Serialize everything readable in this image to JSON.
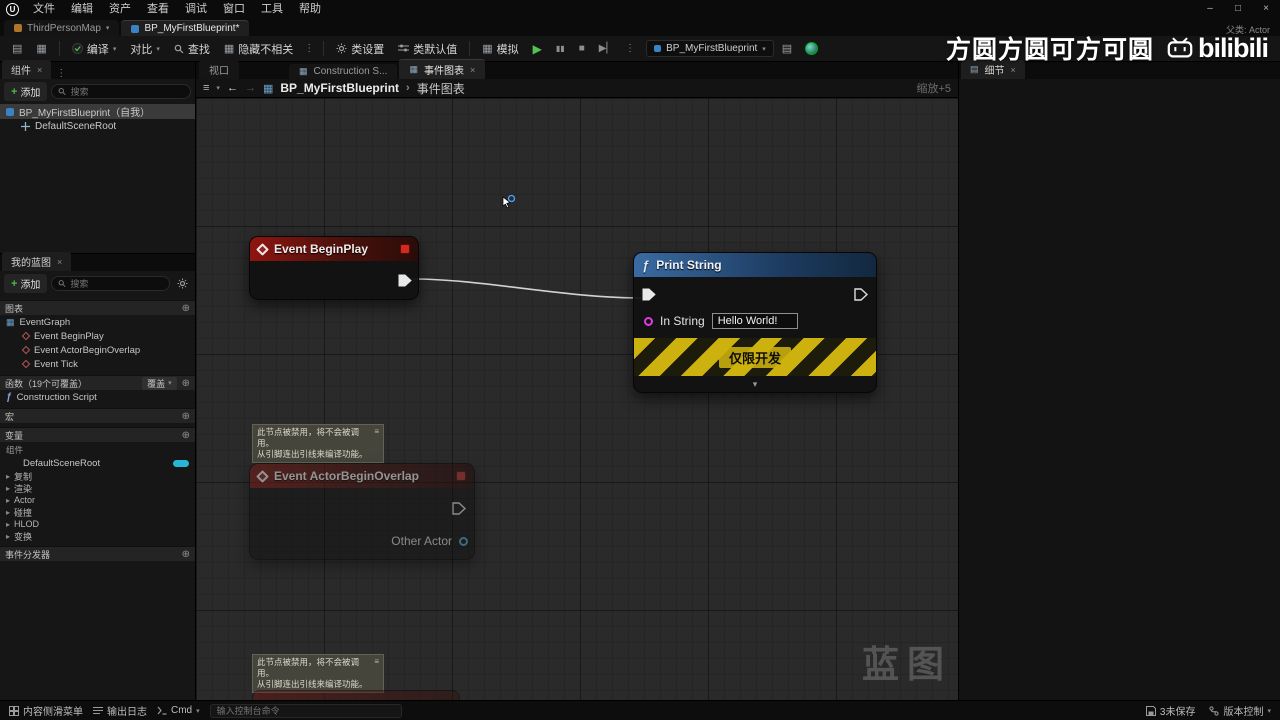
{
  "icons": {
    "logo": "U",
    "minimize": "–",
    "maximize": "□",
    "close": "×",
    "caret_down": "▾",
    "kebab": "⋮",
    "plus": "+",
    "circled_plus": "⊕",
    "play": "▶",
    "pause": "▮▮",
    "stop": "■",
    "skip": "▶▏",
    "back": "←",
    "forward": "→",
    "hamburger": "≡",
    "grid": "▦",
    "crumb_sep": "›",
    "chevron_right": "▸",
    "collapse": "▾",
    "fn": "ƒ",
    "stack": "≡",
    "doc": "▤"
  },
  "menubar": {
    "items": [
      "文件",
      "编辑",
      "资产",
      "查看",
      "调试",
      "窗口",
      "工具",
      "帮助"
    ]
  },
  "tabbar": {
    "level_tab": "ThirdPersonMap",
    "bp_tab": "BP_MyFirstBlueprint*",
    "parent_class": "父类: Actor"
  },
  "toolbar": {
    "compile": "编译",
    "diff": "对比",
    "find": "查找",
    "hide_unrelated": "隐藏不相关",
    "class_settings": "类设置",
    "class_defaults": "类默认值",
    "simulate": "模拟",
    "debug_object": "BP_MyFirstBlueprint"
  },
  "watermark": {
    "text": "方圆方圆可方可圆",
    "logo": "bilibili"
  },
  "components_panel": {
    "tab": "组件",
    "add": "添加",
    "search_placeholder": "搜索",
    "root_item": "BP_MyFirstBlueprint（自我）",
    "child_item": "DefaultSceneRoot"
  },
  "my_blueprint": {
    "tab": "我的蓝图",
    "add": "添加",
    "search_placeholder": "搜索",
    "graphs_header": "图表",
    "graph_name": "EventGraph",
    "events": [
      "Event BeginPlay",
      "Event ActorBeginOverlap",
      "Event Tick"
    ],
    "functions_header": "函数（19个可覆盖）",
    "override_button": "覆盖",
    "function_items": [
      "Construction Script"
    ],
    "macros_header": "宏",
    "variables_header": "变量",
    "component_group": "组件",
    "component_vars": [
      "DefaultSceneRoot"
    ],
    "categories": [
      "复制",
      "渲染",
      "Actor",
      "碰撞",
      "HLOD",
      "变换"
    ],
    "dispatchers_header": "事件分发器"
  },
  "editor": {
    "doc_tabs": [
      "视口",
      "Construction S...",
      "事件图表"
    ],
    "breadcrumb_root": "BP_MyFirstBlueprint",
    "breadcrumb_leaf": "事件图表",
    "zoom": "缩放+5",
    "canvas_watermark": "蓝图"
  },
  "graph": {
    "begin_play": {
      "title": "Event BeginPlay"
    },
    "print_string": {
      "title": "Print String",
      "in_string_label": "In String",
      "in_string_value": "Hello World!",
      "dev_band": "仅限开发"
    },
    "overlap": {
      "title": "Event ActorBeginOverlap",
      "pin_label": "Other Actor"
    },
    "disabled_tip": {
      "line1": "此节点被禁用，将不会被调用。",
      "line2": "从引脚连出引线来编译功能。"
    }
  },
  "details_panel": {
    "tab": "细节"
  },
  "statusbar": {
    "content_drawer": "内容侧滑菜单",
    "output_log": "输出日志",
    "cmd": "Cmd",
    "console_placeholder": "输入控制台命令",
    "unsaved": "3未保存",
    "source_control": "版本控制"
  }
}
